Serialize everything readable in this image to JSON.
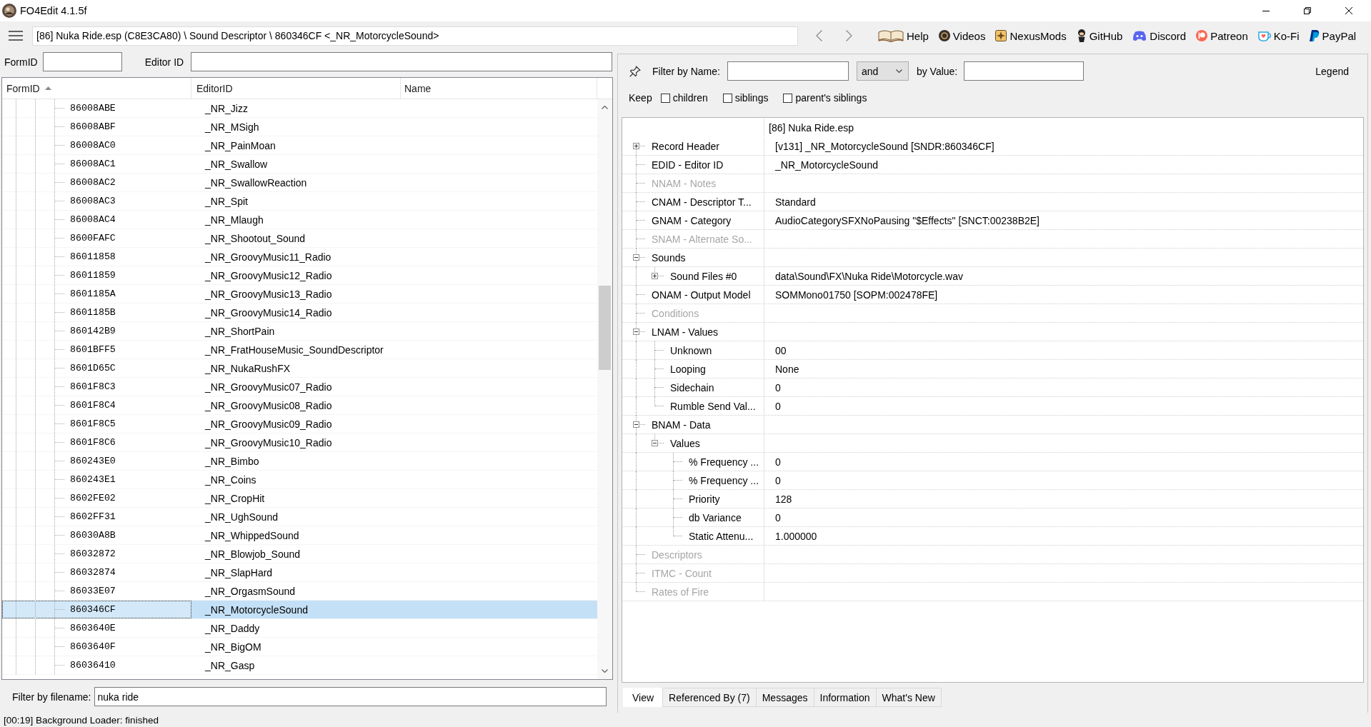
{
  "window": {
    "title": "FO4Edit 4.1.5f"
  },
  "toolbar": {
    "path": "[86] Nuka Ride.esp (C8E3CA80) \\ Sound Descriptor \\ 860346CF <_NR_MotorcycleSound>",
    "links": [
      "Help",
      "Videos",
      "NexusMods",
      "GitHub",
      "Discord",
      "Patreon",
      "Ko-Fi",
      "PayPal"
    ]
  },
  "search": {
    "form_id_label": "FormID",
    "editor_id_label": "Editor ID"
  },
  "record_list": {
    "columns": [
      {
        "label": "FormID",
        "sorted": true
      },
      {
        "label": "EditorID",
        "sorted": false
      },
      {
        "label": "Name",
        "sorted": false
      }
    ],
    "rows": [
      {
        "form_id": "86008ABE",
        "editor_id": "_NR_Jizz",
        "selected": false
      },
      {
        "form_id": "86008ABF",
        "editor_id": "_NR_MSigh",
        "selected": false
      },
      {
        "form_id": "86008AC0",
        "editor_id": "_NR_PainMoan",
        "selected": false
      },
      {
        "form_id": "86008AC1",
        "editor_id": "_NR_Swallow",
        "selected": false
      },
      {
        "form_id": "86008AC2",
        "editor_id": "_NR_SwallowReaction",
        "selected": false
      },
      {
        "form_id": "86008AC3",
        "editor_id": "_NR_Spit",
        "selected": false
      },
      {
        "form_id": "86008AC4",
        "editor_id": "_NR_Mlaugh",
        "selected": false
      },
      {
        "form_id": "8600FAFC",
        "editor_id": "_NR_Shootout_Sound",
        "selected": false
      },
      {
        "form_id": "86011858",
        "editor_id": "_NR_GroovyMusic11_Radio",
        "selected": false
      },
      {
        "form_id": "86011859",
        "editor_id": "_NR_GroovyMusic12_Radio",
        "selected": false
      },
      {
        "form_id": "8601185A",
        "editor_id": "_NR_GroovyMusic13_Radio",
        "selected": false
      },
      {
        "form_id": "8601185B",
        "editor_id": "_NR_GroovyMusic14_Radio",
        "selected": false
      },
      {
        "form_id": "860142B9",
        "editor_id": "_NR_ShortPain",
        "selected": false
      },
      {
        "form_id": "8601BFF5",
        "editor_id": "_NR_FratHouseMusic_SoundDescriptor",
        "selected": false
      },
      {
        "form_id": "8601D65C",
        "editor_id": "_NR_NukaRushFX",
        "selected": false
      },
      {
        "form_id": "8601F8C3",
        "editor_id": "_NR_GroovyMusic07_Radio",
        "selected": false
      },
      {
        "form_id": "8601F8C4",
        "editor_id": "_NR_GroovyMusic08_Radio",
        "selected": false
      },
      {
        "form_id": "8601F8C5",
        "editor_id": "_NR_GroovyMusic09_Radio",
        "selected": false
      },
      {
        "form_id": "8601F8C6",
        "editor_id": "_NR_GroovyMusic10_Radio",
        "selected": false
      },
      {
        "form_id": "860243E0",
        "editor_id": "_NR_Bimbo",
        "selected": false
      },
      {
        "form_id": "860243E1",
        "editor_id": "_NR_Coins",
        "selected": false
      },
      {
        "form_id": "8602FE02",
        "editor_id": "_NR_CropHit",
        "selected": false
      },
      {
        "form_id": "8602FF31",
        "editor_id": "_NR_UghSound",
        "selected": false
      },
      {
        "form_id": "86030A8B",
        "editor_id": "_NR_WhippedSound",
        "selected": false
      },
      {
        "form_id": "86032872",
        "editor_id": "_NR_Blowjob_Sound",
        "selected": false
      },
      {
        "form_id": "86032874",
        "editor_id": "_NR_SlapHard",
        "selected": false
      },
      {
        "form_id": "86033E07",
        "editor_id": "_NR_OrgasmSound",
        "selected": false
      },
      {
        "form_id": "860346CF",
        "editor_id": "_NR_MotorcycleSound",
        "selected": true
      },
      {
        "form_id": "8603640E",
        "editor_id": "_NR_Daddy",
        "selected": false
      },
      {
        "form_id": "8603640F",
        "editor_id": "_NR_BigOM",
        "selected": false
      },
      {
        "form_id": "86036410",
        "editor_id": "_NR_Gasp",
        "selected": false
      }
    ]
  },
  "file_filter": {
    "label": "Filter by filename:",
    "value": "nuka ride"
  },
  "view_filter": {
    "name_label": "Filter by Name:",
    "operator": "and",
    "value_label": "by Value:",
    "legend": "Legend",
    "keep_label": "Keep",
    "keep_options": [
      {
        "label": "children",
        "checked": false
      },
      {
        "label": "siblings",
        "checked": false
      },
      {
        "label": "parent's siblings",
        "checked": false
      }
    ]
  },
  "record_tree": {
    "file_column": "[86] Nuka Ride.esp",
    "nodes": [
      {
        "label": "Record Header",
        "value": "[v131] _NR_MotorcycleSound [SNDR:860346CF]",
        "present": true,
        "expanded": false
      },
      {
        "label": "EDID - Editor ID",
        "value": "_NR_MotorcycleSound",
        "present": true
      },
      {
        "label": "NNAM - Notes",
        "present": false
      },
      {
        "label": "CNAM - Descriptor T...",
        "value": "Standard",
        "present": true
      },
      {
        "label": "GNAM - Category",
        "value": "AudioCategorySFXNoPausing \"$Effects\" [SNCT:00238B2E]",
        "present": true
      },
      {
        "label": "SNAM - Alternate So...",
        "present": false
      },
      {
        "label": "Sounds",
        "present": true,
        "expanded": true,
        "children": [
          {
            "label": "Sound Files #0",
            "value": "data\\Sound\\FX\\Nuka Ride\\Motorcycle.wav",
            "present": true,
            "expanded": false
          }
        ]
      },
      {
        "label": "ONAM - Output Model",
        "value": "SOMMono01750 [SOPM:002478FE]",
        "present": true
      },
      {
        "label": "Conditions",
        "present": false
      },
      {
        "label": "LNAM - Values",
        "present": true,
        "expanded": true,
        "children": [
          {
            "label": "Unknown",
            "value": "00",
            "present": true
          },
          {
            "label": "Looping",
            "value": "None",
            "present": true
          },
          {
            "label": "Sidechain",
            "value": "0",
            "present": true
          },
          {
            "label": "Rumble Send Val...",
            "value": "0",
            "present": true
          }
        ]
      },
      {
        "label": "BNAM - Data",
        "present": true,
        "expanded": true,
        "children": [
          {
            "label": "Values",
            "present": true,
            "expanded": true,
            "children": [
              {
                "label": "% Frequency ...",
                "value": "0",
                "present": true
              },
              {
                "label": "% Frequency ...",
                "value": "0",
                "present": true
              },
              {
                "label": "Priority",
                "value": "128",
                "present": true
              },
              {
                "label": "db Variance",
                "value": "0",
                "present": true
              },
              {
                "label": "Static Attenu...",
                "value": "1.000000",
                "present": true
              }
            ]
          }
        ]
      },
      {
        "label": "Descriptors",
        "present": false
      },
      {
        "label": "ITMC - Count",
        "present": false
      },
      {
        "label": "Rates of Fire",
        "present": false
      }
    ]
  },
  "tabs": [
    {
      "label": "View",
      "selected": true
    },
    {
      "label": "Referenced By (7)",
      "selected": false
    },
    {
      "label": "Messages",
      "selected": false
    },
    {
      "label": "Information",
      "selected": false
    },
    {
      "label": "What's New",
      "selected": false
    }
  ],
  "status_bar": "[00:19] Background Loader: finished"
}
